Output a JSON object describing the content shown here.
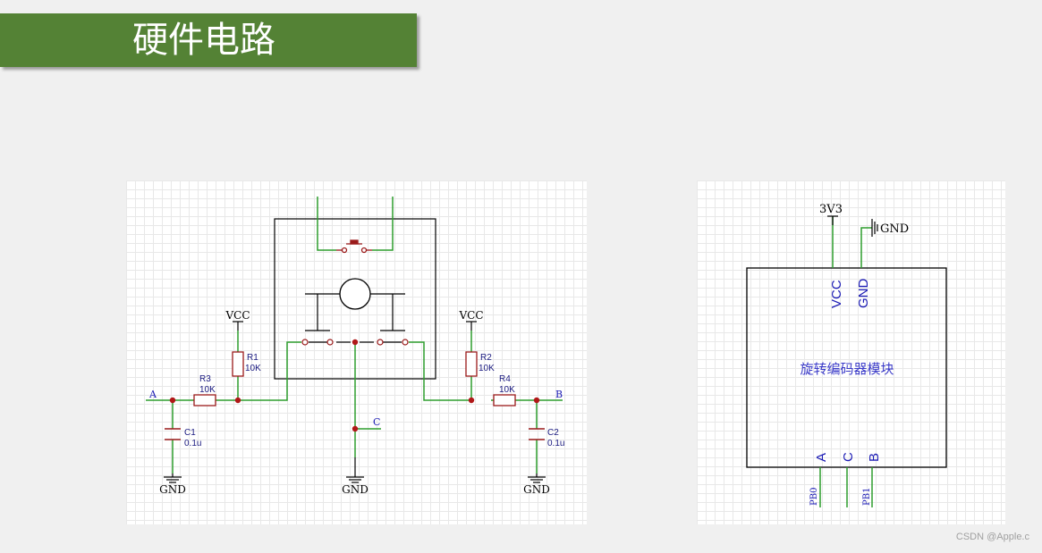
{
  "title": "硬件电路",
  "colors": {
    "title_bg": "#548235",
    "wire": "#2e9d2e",
    "component": "#9a1a1a",
    "junction": "#b01818",
    "net_label": "#1a1ab4"
  },
  "left_schematic": {
    "vcc_left": "VCC",
    "vcc_right": "VCC",
    "r1_ref": "R1",
    "r1_val": "10K",
    "r2_ref": "R2",
    "r2_val": "10K",
    "r3_ref": "R3",
    "r3_val": "10K",
    "r4_ref": "R4",
    "r4_val": "10K",
    "c1_ref": "C1",
    "c1_val": "0.1u",
    "c2_ref": "C2",
    "c2_val": "0.1u",
    "net_a": "A",
    "net_b": "B",
    "net_c": "C",
    "gnd_left": "GND",
    "gnd_center": "GND",
    "gnd_right": "GND"
  },
  "right_schematic": {
    "power_label": "3V3",
    "gnd_label": "GND",
    "pin_vcc": "VCC",
    "pin_gnd": "GND",
    "module_label": "旋转编码器模块",
    "pin_a": "A",
    "pin_c": "C",
    "pin_b": "B",
    "net_pb0": "PB0",
    "net_pb1": "PB1"
  },
  "watermark": "CSDN @Apple.c"
}
